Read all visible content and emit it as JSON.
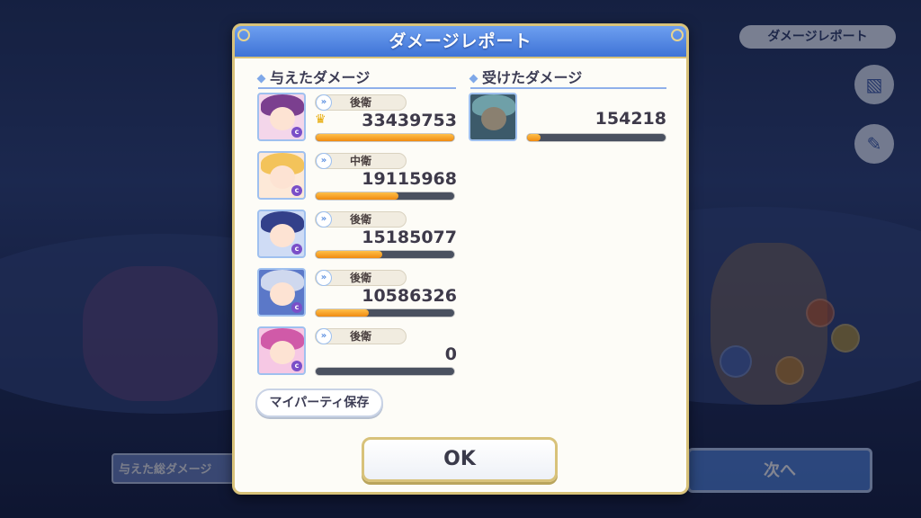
{
  "background": {
    "top_right_button": "ダメージレポート",
    "bottom_left_label": "与えた総ダメージ",
    "next_button": "次へ"
  },
  "dialog": {
    "title": "ダメージレポート",
    "dealt_title": "与えたダメージ",
    "taken_title": "受けたダメージ",
    "dealt": [
      {
        "position": "後衛",
        "damage": "33439753",
        "crown": true,
        "bar_fraction": 1.0,
        "hair_color": "#7b3f8f",
        "bg_color": "#f4d6ea"
      },
      {
        "position": "中衛",
        "damage": "19115968",
        "crown": false,
        "bar_fraction": 0.6,
        "hair_color": "#f3c35a",
        "bg_color": "#fde9d8"
      },
      {
        "position": "後衛",
        "damage": "15185077",
        "crown": false,
        "bar_fraction": 0.48,
        "hair_color": "#33408a",
        "bg_color": "#cfdcf5"
      },
      {
        "position": "後衛",
        "damage": "10586326",
        "crown": false,
        "bar_fraction": 0.38,
        "hair_color": "#cfd8ee",
        "bg_color": "#5b78c8"
      },
      {
        "position": "後衛",
        "damage": "0",
        "crown": false,
        "bar_fraction": 0.0,
        "hair_color": "#d05aa8",
        "bg_color": "#f6c8e4"
      }
    ],
    "taken": [
      {
        "damage": "154218",
        "bar_fraction": 0.1
      }
    ],
    "save_button": "マイパーティ保存",
    "ok_button": "OK"
  },
  "colors": {
    "header_blue": "#3f73d6",
    "frame_gold": "#d8c27a",
    "bar_orange": "#f08a10"
  }
}
